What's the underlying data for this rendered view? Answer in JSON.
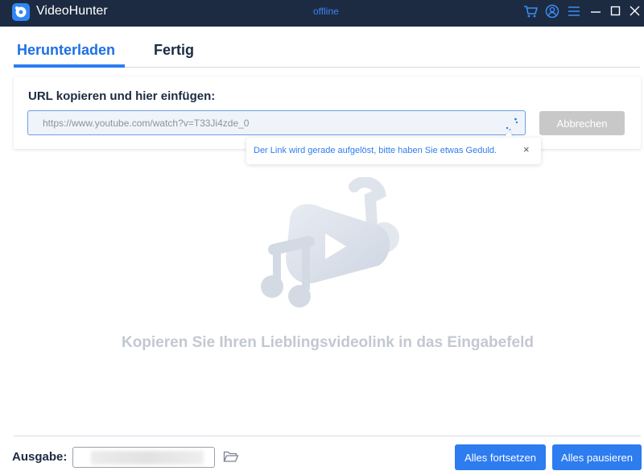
{
  "app": {
    "title": "VideoHunter",
    "status": "offline"
  },
  "titlebar_icons": [
    "cart-icon",
    "user-icon",
    "menu-icon",
    "minimize-icon",
    "maximize-icon",
    "close-icon"
  ],
  "tabs": [
    {
      "label": "Herunterladen",
      "active": true
    },
    {
      "label": "Fertig",
      "active": false
    }
  ],
  "url_panel": {
    "label": "URL kopieren und hier einfügen:",
    "url_value": "https://www.youtube.com/watch?v=T33Ji4zde_0",
    "cancel_label": "Abbrechen"
  },
  "tooltip": {
    "text": "Der Link wird gerade aufgelöst, bitte haben Sie etwas Geduld.",
    "close": "×"
  },
  "empty_state": {
    "message": "Kopieren Sie Ihren Lieblingsvideolink in das Eingabefeld"
  },
  "footer": {
    "output_label": "Ausgabe:",
    "resume_all_label": "Alles fortsetzen",
    "pause_all_label": "Alles pausieren"
  },
  "colors": {
    "titlebar": "#1c2b42",
    "accent": "#2d7cf0",
    "cancel_disabled": "#c8c8c8"
  }
}
